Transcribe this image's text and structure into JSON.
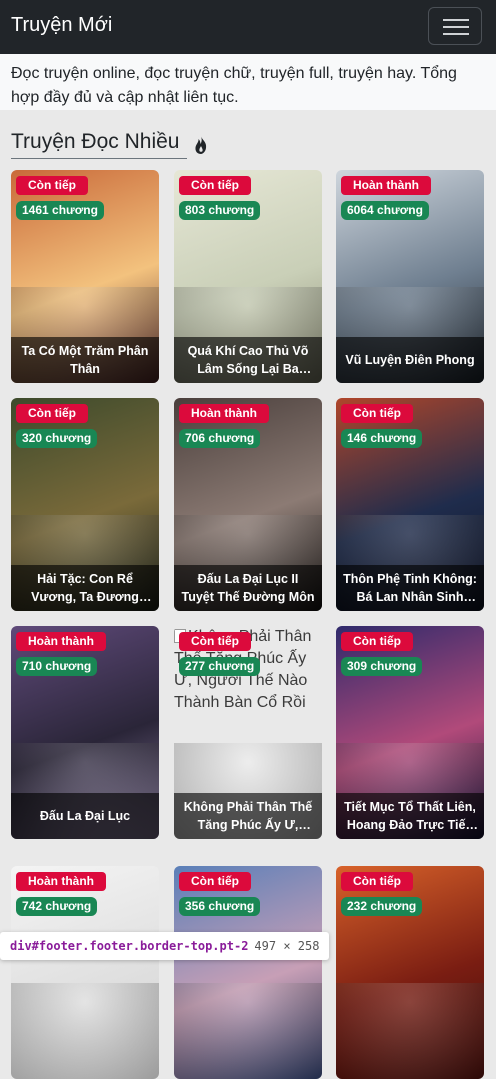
{
  "header": {
    "brand": "Truyện Mới",
    "menu_icon": "hamburger-icon"
  },
  "intro": {
    "text": "Đọc truyện online, đọc truyện chữ, truyện full, truyện hay. Tổng hợp đầy đủ và cập nhật liên tục."
  },
  "section": {
    "title": "Truyện Đọc Nhiều",
    "icon": "fire-icon"
  },
  "cards": [
    {
      "status": "Còn tiếp",
      "chapters": "1461 chương",
      "title": "Ta Có Một Trăm Phân Thân",
      "colors": [
        "#c96a3a",
        "#f3c27e",
        "#5a2b2a"
      ]
    },
    {
      "status": "Còn tiếp",
      "chapters": "803 chương",
      "title": "Quá Khí Cao Thủ Võ Lâm Sống Lại Ba Mươi Năm Trước",
      "colors": [
        "#e6e7d6",
        "#c9cfb7",
        "#8b8c74"
      ]
    },
    {
      "status": "Hoàn thành",
      "chapters": "6064 chương",
      "title": "Vũ Luyện Điên Phong",
      "colors": [
        "#cfd6dd",
        "#6f7f90",
        "#1e2731"
      ]
    },
    {
      "status": "Còn tiếp",
      "chapters": "320 chương",
      "title": "Hải Tặc: Con Rể Vương, Ta Đương Nhiên Thành",
      "colors": [
        "#3d4a2c",
        "#7a6a3a",
        "#1e2418"
      ]
    },
    {
      "status": "Hoàn thành",
      "chapters": "706 chương",
      "title": "Đấu La Đại Lục II Tuyệt Thế Đường Môn",
      "colors": [
        "#4a3f3c",
        "#8c7b74",
        "#1a1614"
      ]
    },
    {
      "status": "Còn tiếp",
      "chapters": "146 chương",
      "title": "Thôn Phệ Tinh Không: Bá Lan Nhân Sinh Mạnh Nhất",
      "colors": [
        "#b0462a",
        "#1f2c4c",
        "#0d1224"
      ]
    },
    {
      "status": "Hoàn thành",
      "chapters": "710 chương",
      "title": "Đấu La Đại Lục",
      "colors": [
        "#5f4a7a",
        "#2a2538",
        "#8c7fa2"
      ]
    },
    {
      "status": "Còn tiếp",
      "chapters": "277 chương",
      "title": "Không Phải Thân Thế Tăng Phúc Ấy Ư, Ngươi Thế Nào Thành Bàn Cổ Rồi",
      "alt": "Không Phải Thân Thế Tăng Phúc Ấy Ư, Ngươi Thế Nào Thành Bàn Cổ Rồi",
      "colors": [
        "#e9e9e9",
        "#e9e9e9",
        "#e9e9e9"
      ]
    },
    {
      "status": "Còn tiếp",
      "chapters": "309 chương",
      "title": "Tiết Mục Tổ Thất Liên, Hoang Đảo Trực Tiếp Của Ta Bị Chiếu Quang",
      "colors": [
        "#2f2a6b",
        "#b14a7a",
        "#14123a"
      ]
    },
    {
      "status": "Hoàn thành",
      "chapters": "742 chương",
      "title": "",
      "colors": [
        "#f4f4f4",
        "#e0e0e0",
        "#cfcfcf"
      ]
    },
    {
      "status": "Còn tiếp",
      "chapters": "356 chương",
      "title": "",
      "colors": [
        "#5a7fb8",
        "#c79fb6",
        "#2c3a62"
      ]
    },
    {
      "status": "Còn tiếp",
      "chapters": "232 chương",
      "title": "",
      "colors": [
        "#d8622a",
        "#7a1d12",
        "#3a0b08"
      ]
    }
  ],
  "inspector": {
    "selector": "div#footer.footer.border-top.pt-2",
    "size": "497 × 258"
  }
}
